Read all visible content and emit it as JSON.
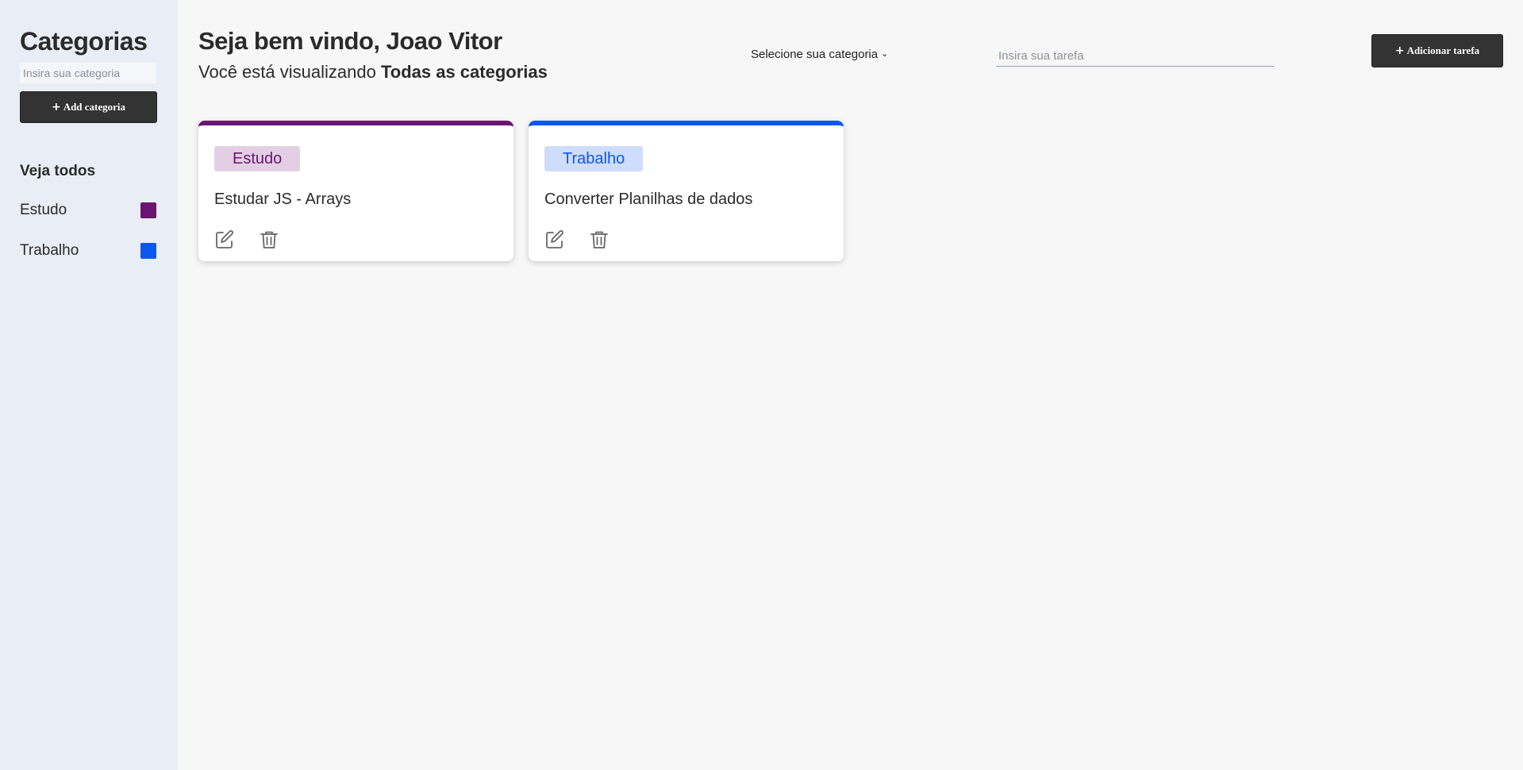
{
  "sidebar": {
    "title": "Categorias",
    "category_input_placeholder": "Insira sua categoria",
    "add_category_label": "Add categoria",
    "see_all_label": "Veja todos",
    "categories": [
      {
        "label": "Estudo",
        "color": "#6a1570"
      },
      {
        "label": "Trabalho",
        "color": "#0b57f0"
      }
    ]
  },
  "header": {
    "greeting": "Seja bem vindo, Joao Vitor",
    "viewing_prefix": "Você está visualizando",
    "viewing_category": "Todas as categorias",
    "category_select_label": "Selecione sua categoria",
    "task_input_placeholder": "Insira sua tarefa",
    "add_task_label": "Adicionar tarefa"
  },
  "tasks": [
    {
      "category": "Estudo",
      "text": "Estudar JS - Arrays",
      "accent_color": "#6a1570",
      "badge_bg": "#e3cfe3",
      "badge_color": "#6a1570"
    },
    {
      "category": "Trabalho",
      "text": "Converter Planilhas de dados",
      "accent_color": "#0b57f0",
      "badge_bg": "#cfdcfb",
      "badge_color": "#0b57f0"
    }
  ],
  "icons": {
    "plus": "plus-icon",
    "chevron": "chevron-down-icon",
    "edit": "edit-icon",
    "delete": "trash-icon"
  }
}
